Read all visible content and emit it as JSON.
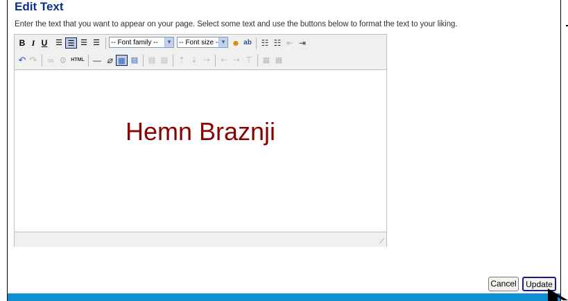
{
  "dialog": {
    "title": "Edit Text",
    "instructions": "Enter the text that you want to appear on your page. Select some text and use the buttons below to format the text to your liking."
  },
  "toolbar": {
    "font_family": "-- Font family --",
    "font_size": "-- Font size --",
    "bold": "B",
    "italic": "I",
    "underline": "U",
    "html_label": "HTML"
  },
  "editor": {
    "content": "Hemn Braznji",
    "content_color": "#8b0000"
  },
  "buttons": {
    "cancel": "Cancel",
    "update": "Update"
  },
  "colors": {
    "title": "#0a2e8c",
    "bottom_bar": "#0e8fd2"
  }
}
